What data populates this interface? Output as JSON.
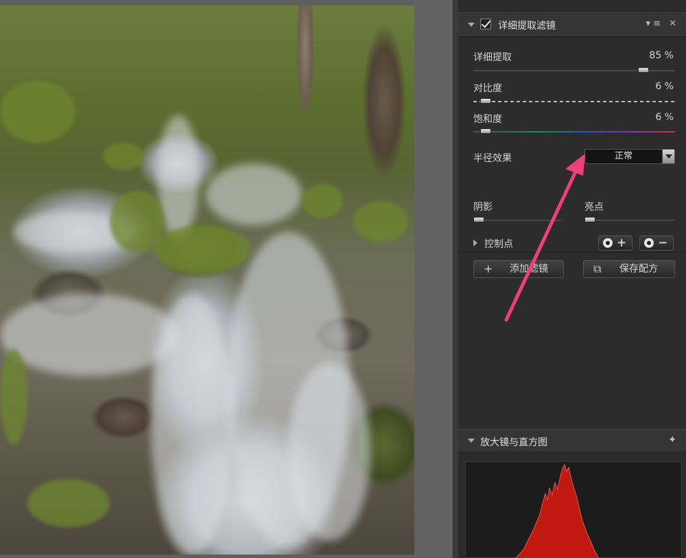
{
  "filter_panel": {
    "title": "详细提取滤镜",
    "header_icons": "▾≡ ✕",
    "enabled": true,
    "sliders": [
      {
        "label": "详细提取",
        "value": "85 %",
        "level": 0.85
      },
      {
        "label": "对比度",
        "value": "6 %",
        "level": 0.06
      },
      {
        "label": "饱和度",
        "value": "6 %",
        "level": 0.06
      }
    ],
    "radius_label": "半径效果",
    "radius_value": "正常",
    "shadow_label": "阴影",
    "highlight_label": "亮点",
    "control_points_label": "控制点",
    "add_filter_label": "添加滤镜",
    "save_recipe_label": "保存配方"
  },
  "histogram_panel": {
    "title": "放大镜与直方图"
  },
  "colors": {
    "accent_arrow": "#f0407a",
    "panel_bg": "#2b2b2b",
    "histogram_red": "#c01a10"
  },
  "icons": [
    "checkbox-check-icon",
    "menu-icon",
    "close-icon",
    "pin-icon",
    "plus-icon",
    "minus-icon",
    "control-point-icon",
    "save-recipe-icon"
  ]
}
